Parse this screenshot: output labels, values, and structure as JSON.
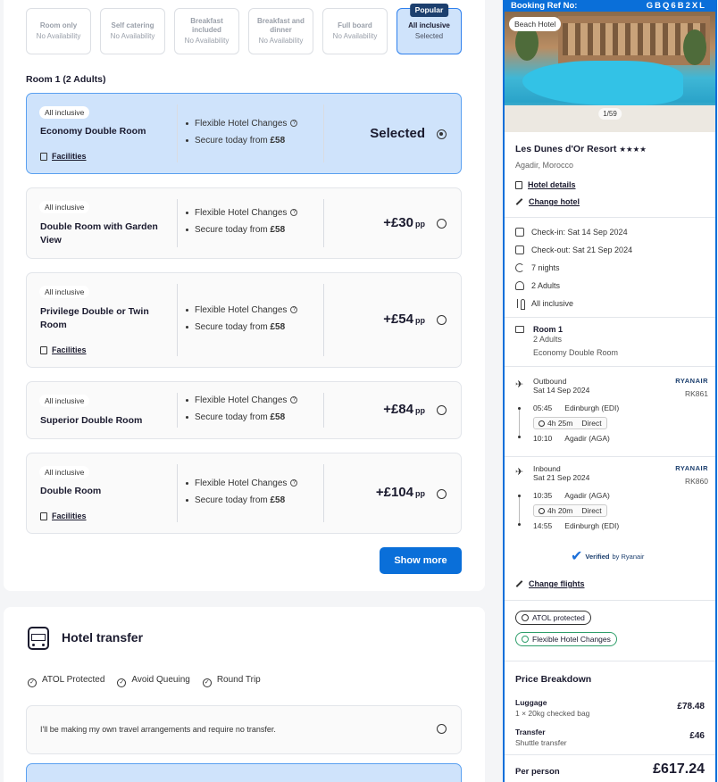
{
  "boards": [
    {
      "name": "Room only",
      "sub": "No Availability"
    },
    {
      "name": "Self catering",
      "sub": "No Availability"
    },
    {
      "name": "Breakfast included",
      "sub": "No Availability"
    },
    {
      "name": "Breakfast and dinner",
      "sub": "No Availability"
    },
    {
      "name": "Full board",
      "sub": "No Availability"
    },
    {
      "name": "All inclusive",
      "sub": "Selected",
      "badge": "Popular"
    }
  ],
  "room_heading": "Room 1 (2 Adults)",
  "rooms": [
    {
      "badge": "All inclusive",
      "name": "Economy Double Room",
      "facilities": "Facilities",
      "feature1": "Flexible Hotel Changes",
      "feature2_prefix": "Secure today from ",
      "feature2_price": "£58",
      "price": "Selected",
      "selected": true
    },
    {
      "badge": "All inclusive",
      "name": "Double Room with Garden View",
      "feature1": "Flexible Hotel Changes",
      "feature2_prefix": "Secure today from ",
      "feature2_price": "£58",
      "price": "+£30",
      "pp": "pp"
    },
    {
      "badge": "All inclusive",
      "name": "Privilege Double or Twin Room",
      "facilities": "Facilities",
      "feature1": "Flexible Hotel Changes",
      "feature2_prefix": "Secure today from ",
      "feature2_price": "£58",
      "price": "+£54",
      "pp": "pp"
    },
    {
      "badge": "All inclusive",
      "name": "Superior Double Room",
      "feature1": "Flexible Hotel Changes",
      "feature2_prefix": "Secure today from ",
      "feature2_price": "£58",
      "price": "+£84",
      "pp": "pp"
    },
    {
      "badge": "All inclusive",
      "name": "Double Room",
      "facilities": "Facilities",
      "feature1": "Flexible Hotel Changes",
      "feature2_prefix": "Secure today from ",
      "feature2_price": "£58",
      "price": "+£104",
      "pp": "pp"
    }
  ],
  "show_more": "Show more",
  "transfer": {
    "title": "Hotel transfer",
    "features": [
      "ATOL Protected",
      "Avoid Queuing",
      "Round Trip"
    ],
    "option_none": "I'll be making my own travel arrangements and require no transfer."
  },
  "summary": {
    "ref_label": "Booking Ref No:",
    "ref_code": "GBQ6B2XL",
    "image_badge": "Beach Hotel",
    "image_count": "1/59",
    "hotel_name": "Les Dunes d'Or Resort",
    "stars": "★★★★",
    "location": "Agadir, Morocco",
    "hotel_details": "Hotel details",
    "change_hotel": "Change hotel",
    "checkin": "Check-in: Sat 14 Sep 2024",
    "checkout": "Check-out: Sat 21 Sep 2024",
    "nights": "7 nights",
    "adults": "2 Adults",
    "board": "All inclusive",
    "room_title": "Room 1",
    "room_adults": "2 Adults",
    "room_type": "Economy Double Room",
    "outbound": {
      "label": "Outbound",
      "date": "Sat 14 Sep 2024",
      "airline": "RYANAIR",
      "flight": "RK861",
      "dep_time": "05:45",
      "dep_airport": "Edinburgh (EDI)",
      "duration": "4h 25m",
      "type": "Direct",
      "arr_time": "10:10",
      "arr_airport": "Agadir (AGA)"
    },
    "inbound": {
      "label": "Inbound",
      "date": "Sat 21 Sep 2024",
      "airline": "RYANAIR",
      "flight": "RK860",
      "dep_time": "10:35",
      "dep_airport": "Agadir (AGA)",
      "duration": "4h 20m",
      "type": "Direct",
      "arr_time": "14:55",
      "arr_airport": "Edinburgh (EDI)"
    },
    "verified_text": "Verified",
    "verified_by": "by Ryanair",
    "change_flights": "Change flights",
    "atol": "ATOL protected",
    "flexible": "Flexible Hotel Changes",
    "price_title": "Price Breakdown",
    "luggage_name": "Luggage",
    "luggage_sub": "1 × 20kg checked bag",
    "luggage_price": "£78.48",
    "transfer_name": "Transfer",
    "transfer_sub": "Shuttle transfer",
    "transfer_price": "£46",
    "per_person_label": "Per person",
    "per_person_price": "£617.24"
  }
}
